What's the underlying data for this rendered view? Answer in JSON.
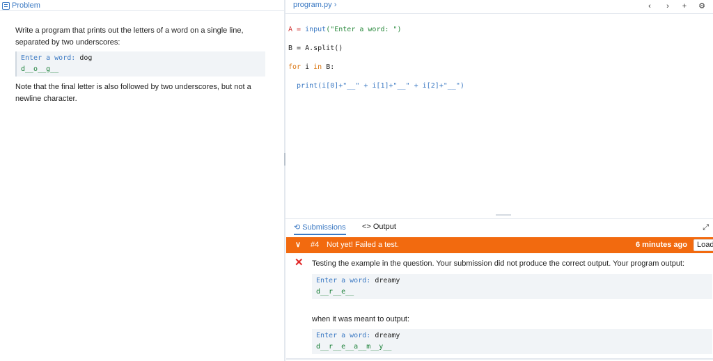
{
  "left_panel": {
    "tab_label": "Problem",
    "description": "Write a program that prints out the letters of a word on a single line, separated by two underscores:",
    "example": {
      "prompt": "Enter a word:",
      "input": "dog",
      "output": "d__o__g__"
    },
    "note": "Note that the final letter is also followed by two underscores, but not a newline character."
  },
  "editor": {
    "file_tab": "program.py",
    "file_tab_arrow": "›",
    "toolbar": {
      "prev": "‹",
      "next": "›",
      "add": "+",
      "settings": "⚙"
    },
    "code_lines": [
      [
        "A = ",
        "input",
        "(\"Enter a word: \")"
      ],
      [
        "B = A.split()"
      ],
      [
        "for",
        " i ",
        "in",
        " B:"
      ],
      [
        "  print(i[0]+\"__\" + i[1]+\"__\" + i[2]+\"__\")"
      ]
    ]
  },
  "bottom": {
    "tabs": {
      "submissions": "Submissions",
      "output": "Output"
    },
    "expand_icon": "⤢",
    "submission": {
      "number": "#4",
      "status": "Not yet! Failed a test.",
      "time": "6 minutes ago",
      "load_button": "Load"
    },
    "test_message": "Testing the example in the question. Your submission did not produce the correct output. Your program output:",
    "your_output": {
      "prompt": "Enter a word:",
      "input": "dreamy",
      "output": "d__r__e__"
    },
    "meant_label": "when it was meant to output:",
    "expected_output": {
      "prompt": "Enter a word:",
      "input": "dreamy",
      "output": "d__r__e__a__m__y__"
    }
  },
  "colors": {
    "accent": "#3b79c3",
    "fail_bar": "#f26a0f",
    "error": "#e02424"
  }
}
